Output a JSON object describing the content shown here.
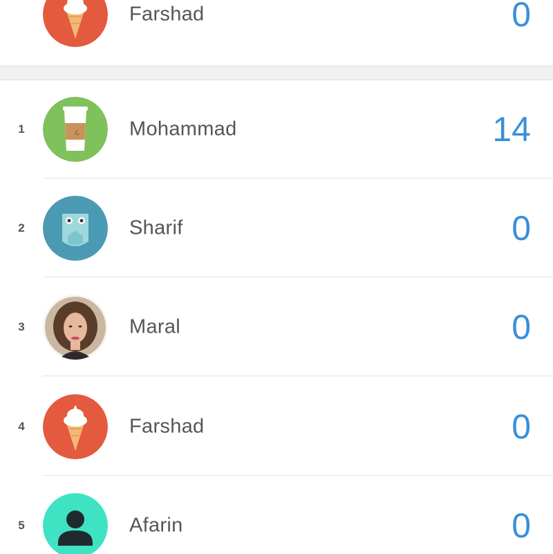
{
  "current_user": {
    "name": "Farshad",
    "score": "0",
    "avatar_icon": "ice-cream-icon"
  },
  "leaderboard": [
    {
      "rank": "1",
      "name": "Mohammad",
      "score": "14",
      "avatar_icon": "coffee-cup-icon"
    },
    {
      "rank": "2",
      "name": "Sharif",
      "score": "0",
      "avatar_icon": "owl-icon"
    },
    {
      "rank": "3",
      "name": "Maral",
      "score": "0",
      "avatar_icon": "user-photo"
    },
    {
      "rank": "4",
      "name": "Farshad",
      "score": "0",
      "avatar_icon": "ice-cream-icon"
    },
    {
      "rank": "5",
      "name": "Afarin",
      "score": "0",
      "avatar_icon": "person-silhouette-icon"
    }
  ],
  "colors": {
    "score_blue": "#3a8fd9",
    "ice_cream_bg": "#e35a3f",
    "coffee_bg": "#7fc15a",
    "owl_bg": "#4b9ab4",
    "silhouette_bg": "#3fe3c4"
  }
}
